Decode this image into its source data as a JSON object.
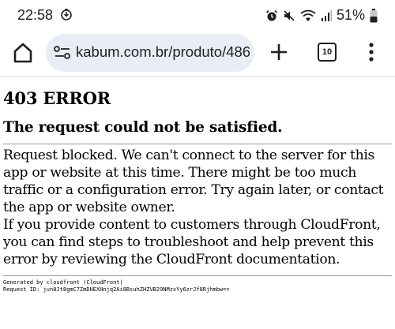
{
  "status_bar": {
    "time": "22:58",
    "battery": "51%"
  },
  "browser": {
    "url": "kabum.com.br/produto/486",
    "tab_count": "10"
  },
  "page": {
    "title": "403 ERROR",
    "subtitle": "The request could not be satisfied.",
    "message_1": "Request blocked. We can't connect to the server for this app or website at this time. There might be too much traffic or a configuration error. Try again later, or contact the app or website owner.",
    "message_2": "If you provide content to customers through CloudFront, you can find steps to troubleshoot and help prevent this error by reviewing the CloudFront documentation.",
    "generated_by": "Generated by cloudfront (CloudFront)",
    "request_id": "Request ID: jun8Jt8gmC7ZmDHEXHnjq2Ai8BsuhZHZVB29NMzxYy6zrJf8Rjhmbw=="
  },
  "icons": {
    "status_left": "reduce-data-icon",
    "alarm": "alarm-icon",
    "mute": "mute-icon",
    "wifi": "wifi-icon",
    "signal": "signal-icon",
    "battery": "battery-icon",
    "home": "home-icon",
    "site_settings": "tune-icon",
    "new_tab": "plus-icon",
    "menu": "more-vert-icon"
  }
}
